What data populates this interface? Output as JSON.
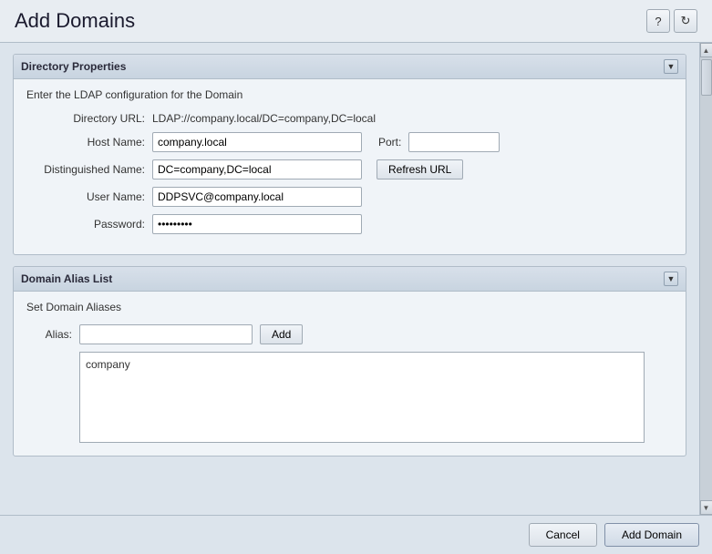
{
  "header": {
    "title": "Add Domains",
    "help_icon": "?",
    "refresh_icon": "↻"
  },
  "directory_properties_panel": {
    "title": "Directory Properties",
    "subtitle": "Enter the LDAP configuration for the Domain",
    "collapse_icon": "▼",
    "fields": {
      "directory_url_label": "Directory URL:",
      "directory_url_value": "LDAP://company.local/DC=company,DC=local",
      "host_name_label": "Host Name:",
      "host_name_value": "company.local",
      "host_name_placeholder": "",
      "port_label": "Port:",
      "port_value": "",
      "port_placeholder": "",
      "distinguished_name_label": "Distinguished Name:",
      "distinguished_name_value": "DC=company,DC=local",
      "distinguished_name_placeholder": "",
      "refresh_url_label": "Refresh URL",
      "user_name_label": "User Name:",
      "user_name_value": "DDPSVC@company.local",
      "user_name_placeholder": "",
      "password_label": "Password:",
      "password_value": "••••••••"
    }
  },
  "domain_alias_panel": {
    "title": "Domain Alias List",
    "subtitle": "Set Domain Aliases",
    "collapse_icon": "▼",
    "alias_label": "Alias:",
    "alias_value": "",
    "alias_placeholder": "",
    "add_button_label": "Add",
    "alias_list_items": [
      "company"
    ]
  },
  "footer": {
    "cancel_label": "Cancel",
    "add_domain_label": "Add Domain"
  },
  "scrollbar": {
    "up_arrow": "▲",
    "down_arrow": "▼"
  }
}
